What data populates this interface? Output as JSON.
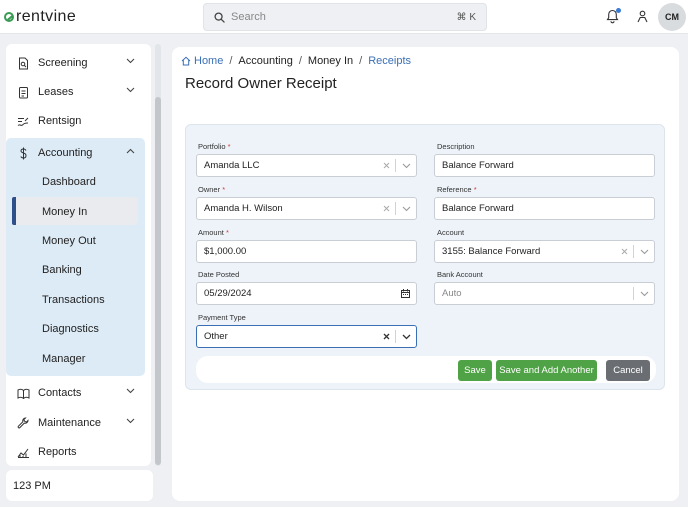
{
  "header": {
    "logo_text": "rentvine",
    "search_placeholder": "Search",
    "search_shortcut": "⌘ K",
    "avatar_initials": "CM",
    "icons": [
      "search-icon",
      "bell-icon",
      "person-icon"
    ],
    "notification_dot_color": "#3a7bd5"
  },
  "sidebar": {
    "items": [
      {
        "label": "Screening",
        "icon": "screening-icon"
      },
      {
        "label": "Leases",
        "icon": "leases-icon"
      },
      {
        "label": "Rentsign",
        "icon": "rentsign-icon"
      },
      {
        "label": "Accounting",
        "icon": "dollar-icon"
      },
      {
        "label": "Contacts",
        "icon": "contacts-icon"
      },
      {
        "label": "Maintenance",
        "icon": "wrench-icon"
      },
      {
        "label": "Reports",
        "icon": "reports-icon"
      }
    ],
    "accounting_sub": [
      "Dashboard",
      "Money In",
      "Money Out",
      "Banking",
      "Transactions",
      "Diagnostics",
      "Manager"
    ],
    "active_sub": "Money In",
    "time": "123 PM"
  },
  "breadcrumb": {
    "home": "Home",
    "accounting": "Accounting",
    "money_in": "Money In",
    "receipts": "Receipts"
  },
  "page": {
    "title": "Record Owner Receipt"
  },
  "form": {
    "portfolio": {
      "label": "Portfolio",
      "value": "Amanda LLC"
    },
    "owner": {
      "label": "Owner",
      "value": "Amanda H. Wilson"
    },
    "amount": {
      "label": "Amount",
      "value": "$1,000.00"
    },
    "date_posted": {
      "label": "Date Posted",
      "value": "05/29/2024"
    },
    "payment_type": {
      "label": "Payment Type",
      "value": "Other"
    },
    "description": {
      "label": "Description",
      "value": "Balance Forward"
    },
    "reference": {
      "label": "Reference",
      "value": "Balance Forward"
    },
    "account": {
      "label": "Account",
      "value": "3155: Balance Forward"
    },
    "bank_account": {
      "label": "Bank Account",
      "placeholder": "Auto"
    },
    "required_mark": "*"
  },
  "buttons": {
    "save": "Save",
    "save_add": "Save and Add Another",
    "cancel": "Cancel"
  },
  "colors": {
    "accent": "#3a6fb5",
    "save_green": "#4fa245",
    "cancel_gray": "#6a6e73",
    "accounting_bg": "#ddebf6"
  }
}
